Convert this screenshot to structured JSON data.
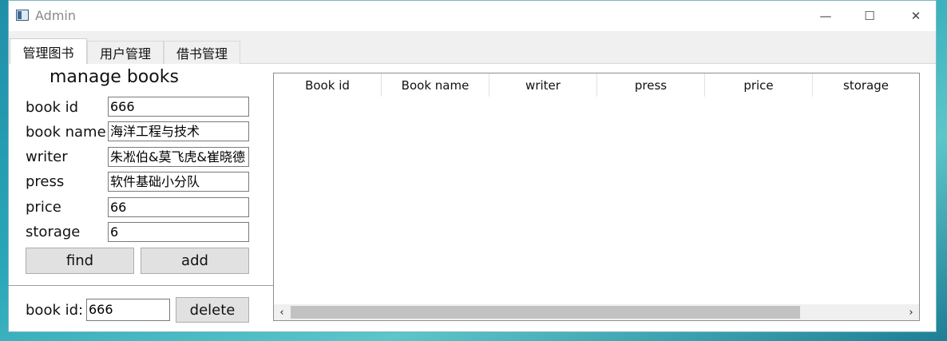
{
  "window": {
    "title": "Admin",
    "minimize_glyph": "—",
    "maximize_glyph": "☐",
    "close_glyph": "✕"
  },
  "tabs": [
    {
      "label": "管理图书",
      "active": true
    },
    {
      "label": "用户管理",
      "active": false
    },
    {
      "label": "借书管理",
      "active": false
    }
  ],
  "form": {
    "heading": "manage books",
    "fields": [
      {
        "label": "book id",
        "value": "666"
      },
      {
        "label": "book name",
        "value": "海洋工程与技术"
      },
      {
        "label": "writer",
        "value": "朱凇伯&莫飞虎&崔晓德"
      },
      {
        "label": "press",
        "value": "软件基础小分队"
      },
      {
        "label": "price",
        "value": "66"
      },
      {
        "label": "storage",
        "value": "6"
      }
    ],
    "find_label": "find",
    "add_label": "add"
  },
  "delete_section": {
    "label": "book id:",
    "value": "666",
    "delete_label": "delete"
  },
  "table": {
    "columns": [
      "Book id",
      "Book name",
      "writer",
      "press",
      "price",
      "storage"
    ],
    "rows": [],
    "scroll_left_glyph": "‹",
    "scroll_right_glyph": "›"
  },
  "icons": {
    "app": "window-app-icon",
    "minimize": "minimize-icon",
    "maximize": "maximize-icon",
    "close": "close-icon"
  }
}
